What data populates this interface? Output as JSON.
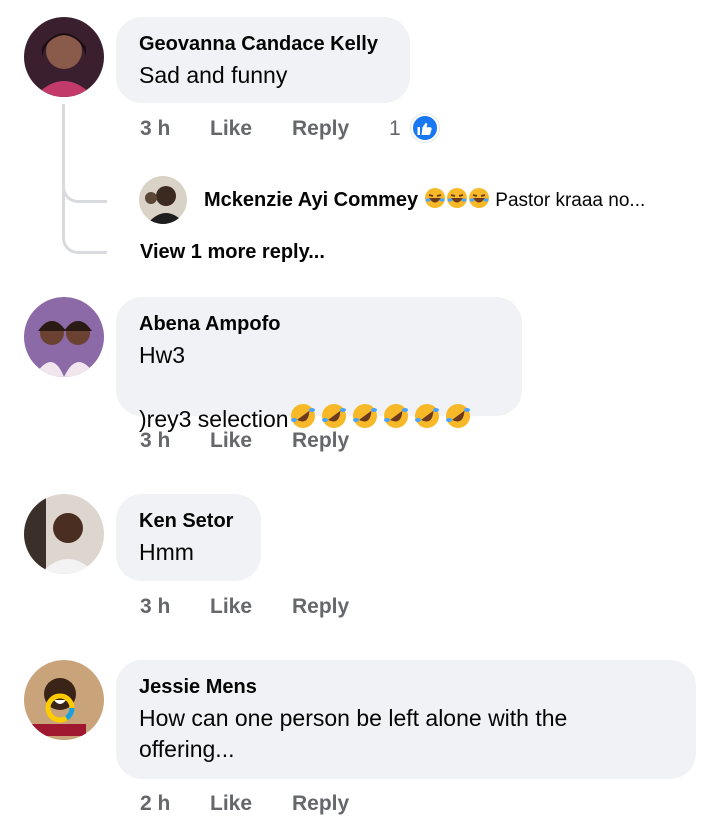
{
  "comments": [
    {
      "author": "Geovanna Candace Kelly",
      "text": "Sad and funny",
      "time": "3 h",
      "like_label": "Like",
      "reply_label": "Reply",
      "reaction_count": "1",
      "reaction_icon": "like-reaction-icon"
    },
    {
      "author": "Abena Ampofo",
      "text_line1": "Hw3",
      "text_line2": ")rey3 selection",
      "emoji_count": 6,
      "time": "3 h",
      "like_label": "Like",
      "reply_label": "Reply"
    },
    {
      "author": "Ken Setor",
      "text": "Hmm",
      "time": "3 h",
      "like_label": "Like",
      "reply_label": "Reply"
    },
    {
      "author": "Jessie Mens",
      "text": "How can one person be left alone with the\noffering...",
      "time": "2 h",
      "like_label": "Like",
      "reply_label": "Reply"
    }
  ],
  "reply_preview": {
    "author": "Mckenzie Ayi Commey",
    "text": "Pastor kraaa no..."
  },
  "view_more_replies": "View 1 more reply...",
  "colors": {
    "bubble": "#f0f2f5",
    "secondary_text": "#65676b",
    "like_blue": "#1877f2",
    "emoji_yellow": "#f7b928"
  }
}
